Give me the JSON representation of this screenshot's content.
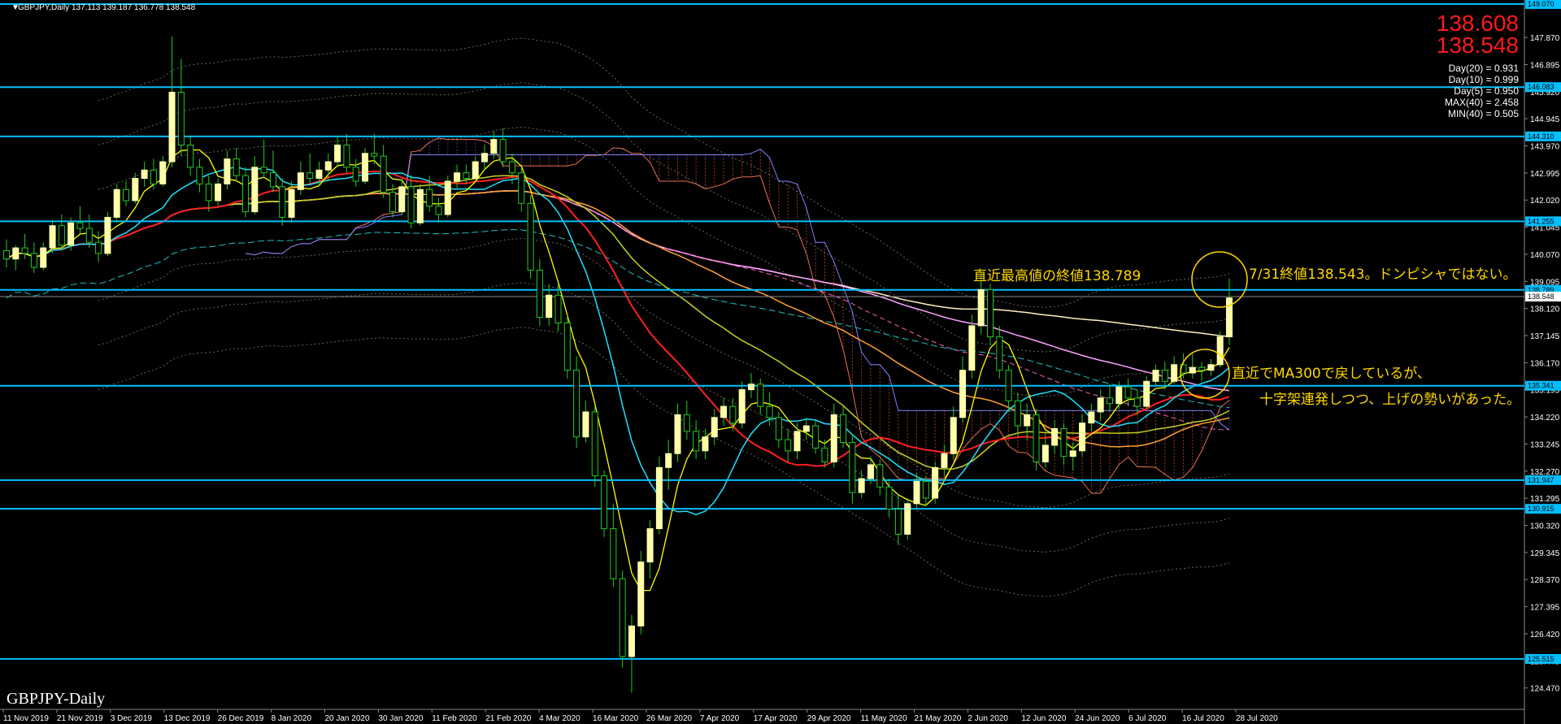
{
  "header": {
    "symbol_line": "GBPJPY,Daily  137.113 139.187 136.778 138.548",
    "menu_glyph": "▼"
  },
  "title_label": "GBPJPY-Daily",
  "price_display": {
    "ask": "138.608",
    "bid": "138.548"
  },
  "stats": [
    "Day(20) = 0.931",
    "Day(10) = 0.999",
    "Day(5) = 0.950",
    "MAX(40) = 2.458",
    "MIN(40) = 0.505"
  ],
  "annotations": {
    "recent_high": "直近最高値の終値138.789",
    "close_note": "7/31終値138.543。ドンピシャではない。",
    "ma_line1": "直近でMA300で戻しているが、",
    "ma_line2": "十字架連発しつつ、上げの勢いがあった。"
  },
  "colors": {
    "background": "#000000",
    "hline": "#00bfff",
    "bull_candle": "#ffffaa",
    "bear_candle": "#22cc22",
    "ma_red": "#ff2020",
    "ma_yellow": "#ffff00",
    "ma_cyan": "#20e0ff",
    "ma_olive": "#c8d020",
    "ma_orange": "#ffa030",
    "ma_pink": "#ffa0ff",
    "ma_white": "#fff0c0",
    "annotation": "#ffd700",
    "price_red": "#ff1a1a"
  },
  "chart_data": {
    "type": "candlestick",
    "symbol": "GBPJPY",
    "timeframe": "Daily",
    "ylim": [
      123.7,
      149.1
    ],
    "y_ticks": [
      "147.870",
      "146.895",
      "145.920",
      "144.945",
      "143.970",
      "142.995",
      "142.020",
      "141.045",
      "140.070",
      "139.095",
      "138.120",
      "137.145",
      "136.170",
      "135.195",
      "134.220",
      "133.245",
      "132.270",
      "131.295",
      "130.320",
      "129.345",
      "128.370",
      "127.395",
      "126.420",
      "125.445",
      "124.470"
    ],
    "x_dates": [
      "11 Nov 2019",
      "21 Nov 2019",
      "3 Dec 2019",
      "13 Dec 2019",
      "26 Dec 2019",
      "8 Jan 2020",
      "20 Jan 2020",
      "30 Jan 2020",
      "11 Feb 2020",
      "21 Feb 2020",
      "4 Mar 2020",
      "16 Mar 2020",
      "26 Mar 2020",
      "7 Apr 2020",
      "17 Apr 2020",
      "29 Apr 2020",
      "11 May 2020",
      "21 May 2020",
      "2 Jun 2020",
      "12 Jun 2020",
      "24 Jun 2020",
      "6 Jul 2020",
      "16 Jul 2020",
      "28 Jul 2020"
    ],
    "horizontal_levels": [
      {
        "value": 149.07,
        "tag": "149.070"
      },
      {
        "value": 146.083,
        "tag": "146.083"
      },
      {
        "value": 144.31,
        "tag": "144.310"
      },
      {
        "value": 141.255,
        "tag": "141.255"
      },
      {
        "value": 138.789,
        "tag": "138.789"
      },
      {
        "value": 135.341,
        "tag": "135.341"
      },
      {
        "value": 131.947,
        "tag": "131.947"
      },
      {
        "value": 130.915,
        "tag": "130.915"
      },
      {
        "value": 125.515,
        "tag": "125.515"
      }
    ],
    "current_price": {
      "value": 138.548,
      "tag": "138.548"
    },
    "ohlc": [
      [
        140.2,
        140.6,
        139.6,
        139.9
      ],
      [
        139.9,
        140.4,
        139.5,
        140.3
      ],
      [
        140.3,
        140.8,
        139.9,
        140.1
      ],
      [
        140.1,
        140.5,
        139.4,
        139.6
      ],
      [
        139.6,
        140.5,
        139.5,
        140.3
      ],
      [
        140.3,
        141.3,
        140.1,
        141.1
      ],
      [
        141.1,
        141.5,
        140.2,
        140.4
      ],
      [
        140.4,
        141.4,
        140.2,
        141.2
      ],
      [
        141.2,
        141.8,
        140.8,
        141.0
      ],
      [
        141.0,
        141.5,
        140.3,
        140.5
      ],
      [
        140.5,
        140.9,
        139.8,
        140.1
      ],
      [
        140.1,
        141.6,
        140.0,
        141.4
      ],
      [
        141.4,
        142.6,
        141.2,
        142.4
      ],
      [
        142.4,
        142.7,
        141.8,
        142.0
      ],
      [
        142.0,
        143.0,
        141.9,
        142.8
      ],
      [
        142.8,
        143.4,
        142.5,
        143.1
      ],
      [
        143.1,
        143.5,
        142.4,
        142.6
      ],
      [
        142.6,
        143.6,
        142.5,
        143.4
      ],
      [
        143.4,
        147.9,
        143.2,
        145.9
      ],
      [
        145.9,
        147.1,
        143.6,
        144.0
      ],
      [
        144.0,
        144.3,
        142.9,
        143.2
      ],
      [
        143.2,
        143.5,
        142.3,
        142.6
      ],
      [
        142.6,
        142.9,
        141.6,
        142.0
      ],
      [
        142.0,
        142.8,
        141.8,
        142.6
      ],
      [
        142.6,
        143.8,
        142.4,
        143.5
      ],
      [
        143.5,
        143.9,
        142.7,
        142.9
      ],
      [
        142.9,
        143.2,
        141.4,
        141.6
      ],
      [
        141.6,
        143.6,
        141.5,
        143.2
      ],
      [
        143.2,
        144.2,
        142.8,
        143.0
      ],
      [
        143.0,
        143.8,
        142.3,
        142.5
      ],
      [
        142.5,
        142.8,
        141.1,
        141.4
      ],
      [
        141.4,
        142.7,
        141.2,
        142.4
      ],
      [
        142.4,
        143.4,
        142.2,
        143.0
      ],
      [
        143.0,
        143.7,
        142.6,
        142.8
      ],
      [
        142.8,
        143.4,
        142.5,
        143.1
      ],
      [
        143.1,
        143.7,
        142.7,
        143.4
      ],
      [
        143.4,
        144.3,
        143.2,
        144.0
      ],
      [
        144.0,
        144.4,
        143.0,
        143.2
      ],
      [
        143.2,
        143.5,
        142.5,
        142.7
      ],
      [
        142.7,
        143.9,
        142.6,
        143.7
      ],
      [
        143.7,
        144.4,
        143.3,
        143.6
      ],
      [
        143.6,
        144.0,
        142.1,
        142.3
      ],
      [
        142.3,
        142.6,
        141.4,
        141.6
      ],
      [
        141.6,
        142.8,
        141.5,
        142.5
      ],
      [
        142.5,
        142.9,
        141.0,
        141.2
      ],
      [
        141.2,
        142.6,
        141.1,
        142.4
      ],
      [
        142.4,
        142.9,
        141.6,
        141.8
      ],
      [
        141.8,
        142.1,
        141.2,
        141.5
      ],
      [
        141.5,
        142.9,
        141.4,
        142.7
      ],
      [
        142.7,
        143.3,
        142.4,
        143.0
      ],
      [
        143.0,
        143.3,
        142.6,
        142.8
      ],
      [
        142.8,
        143.6,
        142.7,
        143.4
      ],
      [
        143.4,
        144.0,
        143.1,
        143.7
      ],
      [
        143.7,
        144.5,
        143.5,
        144.2
      ],
      [
        144.2,
        144.6,
        143.2,
        143.4
      ],
      [
        143.4,
        143.7,
        142.6,
        143.0
      ],
      [
        143.0,
        143.2,
        141.6,
        141.9
      ],
      [
        141.9,
        142.2,
        139.2,
        139.5
      ],
      [
        139.5,
        139.9,
        137.5,
        137.8
      ],
      [
        137.8,
        139.0,
        137.5,
        138.6
      ],
      [
        138.6,
        139.0,
        137.3,
        137.6
      ],
      [
        137.6,
        137.9,
        135.6,
        135.9
      ],
      [
        135.9,
        136.4,
        133.1,
        133.5
      ],
      [
        133.5,
        134.8,
        133.3,
        134.4
      ],
      [
        134.4,
        134.6,
        131.7,
        132.1
      ],
      [
        132.1,
        132.3,
        129.9,
        130.2
      ],
      [
        130.2,
        131.1,
        128.1,
        128.4
      ],
      [
        128.4,
        128.7,
        125.2,
        125.6
      ],
      [
        125.6,
        127.1,
        124.3,
        126.7
      ],
      [
        126.7,
        129.4,
        126.4,
        129.0
      ],
      [
        129.0,
        130.5,
        128.4,
        130.2
      ],
      [
        130.2,
        132.8,
        130.0,
        132.4
      ],
      [
        132.4,
        133.4,
        131.6,
        132.9
      ],
      [
        132.9,
        134.7,
        132.6,
        134.3
      ],
      [
        134.3,
        134.8,
        133.4,
        133.7
      ],
      [
        133.7,
        134.1,
        132.7,
        133.0
      ],
      [
        133.0,
        133.8,
        132.7,
        133.5
      ],
      [
        133.5,
        134.5,
        133.2,
        134.2
      ],
      [
        134.2,
        134.9,
        133.9,
        134.6
      ],
      [
        134.6,
        134.9,
        133.7,
        134.0
      ],
      [
        134.0,
        135.5,
        133.8,
        135.2
      ],
      [
        135.2,
        135.8,
        134.9,
        135.4
      ],
      [
        135.4,
        135.6,
        134.3,
        134.6
      ],
      [
        134.6,
        135.1,
        133.9,
        134.2
      ],
      [
        134.2,
        134.4,
        133.1,
        133.4
      ],
      [
        133.4,
        133.8,
        132.6,
        133.0
      ],
      [
        133.0,
        134.0,
        132.7,
        133.7
      ],
      [
        133.7,
        134.2,
        133.4,
        133.9
      ],
      [
        133.9,
        134.1,
        132.9,
        133.1
      ],
      [
        133.1,
        133.4,
        132.4,
        132.6
      ],
      [
        132.6,
        134.7,
        132.4,
        134.3
      ],
      [
        134.3,
        134.6,
        133.1,
        133.3
      ],
      [
        133.3,
        133.6,
        131.1,
        131.5
      ],
      [
        131.5,
        132.3,
        131.3,
        132.0
      ],
      [
        132.0,
        132.8,
        131.8,
        132.5
      ],
      [
        132.5,
        132.7,
        131.4,
        131.7
      ],
      [
        131.7,
        132.0,
        130.6,
        130.9
      ],
      [
        130.9,
        131.4,
        129.6,
        130.0
      ],
      [
        130.0,
        131.3,
        129.8,
        131.1
      ],
      [
        131.1,
        132.2,
        130.9,
        131.9
      ],
      [
        131.9,
        132.1,
        131.0,
        131.3
      ],
      [
        131.3,
        132.6,
        131.1,
        132.4
      ],
      [
        132.4,
        133.2,
        132.1,
        132.9
      ],
      [
        132.9,
        134.6,
        132.7,
        134.2
      ],
      [
        134.2,
        136.4,
        134.0,
        135.9
      ],
      [
        135.9,
        137.9,
        135.6,
        137.5
      ],
      [
        137.5,
        139.4,
        137.2,
        138.8
      ],
      [
        138.8,
        139.0,
        136.8,
        137.1
      ],
      [
        137.1,
        137.5,
        135.6,
        135.9
      ],
      [
        135.9,
        136.1,
        134.4,
        134.8
      ],
      [
        134.8,
        135.1,
        133.5,
        133.9
      ],
      [
        133.9,
        134.7,
        133.4,
        134.3
      ],
      [
        134.3,
        134.5,
        132.3,
        132.6
      ],
      [
        132.6,
        133.6,
        132.4,
        133.2
      ],
      [
        133.2,
        134.1,
        132.9,
        133.8
      ],
      [
        133.8,
        134.0,
        132.5,
        132.8
      ],
      [
        132.8,
        133.3,
        132.3,
        133.0
      ],
      [
        133.0,
        134.3,
        132.8,
        134.0
      ],
      [
        134.0,
        134.7,
        133.7,
        134.4
      ],
      [
        134.4,
        135.2,
        134.1,
        134.9
      ],
      [
        134.9,
        135.4,
        134.4,
        134.7
      ],
      [
        134.7,
        135.5,
        134.5,
        135.3
      ],
      [
        135.3,
        135.6,
        134.6,
        134.9
      ],
      [
        134.9,
        135.2,
        134.3,
        134.6
      ],
      [
        134.6,
        135.7,
        134.5,
        135.5
      ],
      [
        135.5,
        136.1,
        135.3,
        135.9
      ],
      [
        135.9,
        136.2,
        135.2,
        135.5
      ],
      [
        135.5,
        136.4,
        135.4,
        136.1
      ],
      [
        136.1,
        136.5,
        135.6,
        135.8
      ],
      [
        135.8,
        136.5,
        135.6,
        136.0
      ],
      [
        136.0,
        136.2,
        135.5,
        135.9
      ],
      [
        135.9,
        136.3,
        135.7,
        136.1
      ],
      [
        136.1,
        137.3,
        136.0,
        137.1
      ],
      [
        137.1,
        139.2,
        136.8,
        138.5
      ]
    ]
  }
}
